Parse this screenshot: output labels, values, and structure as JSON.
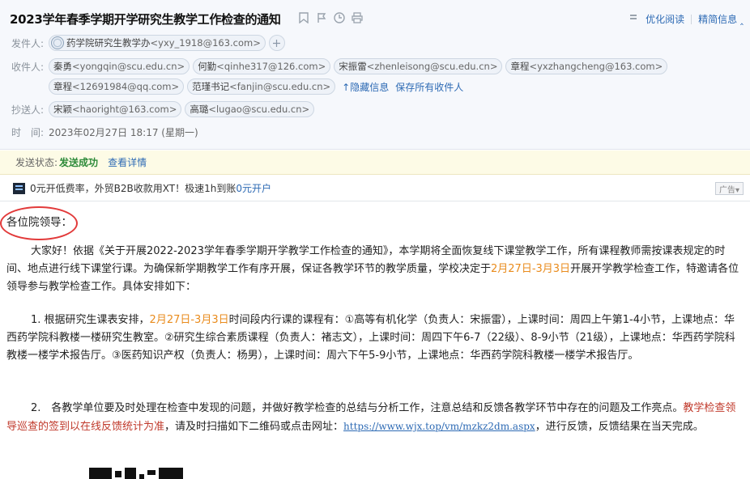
{
  "subject": "2023学年春季学期开学研究生教学工作检查的通知",
  "toolbar": {
    "optimize_read": "优化阅读",
    "collapse_info": "精简信息",
    "collapse_arrow": "‸"
  },
  "from": {
    "label": "发件人:",
    "name": "药学院研究生教学办",
    "email": "<yxy_1918@163.com>"
  },
  "to": {
    "label": "收件人:",
    "recipients": [
      {
        "name": "秦勇",
        "email": "<yongqin@scu.edu.cn>"
      },
      {
        "name": "何勤",
        "email": "<qinhe317@126.com>"
      },
      {
        "name": "宋振雷",
        "email": "<zhenleisong@scu.edu.cn>"
      },
      {
        "name": "章程",
        "email": "<yxzhangcheng@163.com>"
      },
      {
        "name": "章程",
        "email": "<12691984@qq.com>"
      },
      {
        "name": "范瑾书记",
        "email": "<fanjin@scu.edu.cn>"
      }
    ],
    "hide_label": "↑隐藏信息",
    "save_label": "保存所有收件人"
  },
  "cc": {
    "label": "抄送人:",
    "recipients": [
      {
        "name": "宋颖",
        "email": "<haoright@163.com>"
      },
      {
        "name": "高璐",
        "email": "<lugao@scu.edu.cn>"
      }
    ]
  },
  "time": {
    "label": "时　间:",
    "value": "2023年02月27日 18:17 (星期一)"
  },
  "status": {
    "label": "发送状态:",
    "value": "发送成功",
    "details": "查看详情"
  },
  "ad": {
    "text": "0元开低费率，外贸B2B收款用XT！极速1h到账 ",
    "link": "0元开户",
    "badge": "广告▾"
  },
  "body": {
    "greeting": "各位院领导：",
    "p1_a": "大家好！依据《关于开展2022-2023学年春季学期开学教学工作检查的通知》，本学期将全面恢复线下课堂教学工作，所有课程教师需按课表规定的时间、地点进行线下课堂行课。为确保新学期教学工作有序开展，保证各教学环节的教学质量，学校决定于",
    "p1_date": "2月27日-3月3日",
    "p1_b": "开展开学教学检查工作，特邀请各位领导参与教学检查工作。具体安排如下：",
    "p2_a": "1. 根据研究生课表安排，",
    "p2_date": "2月27日-3月3日",
    "p2_b": "时间段内行课的课程有：①高等有机化学（负责人：宋振雷），上课时间：周四上午第1-4小节，上课地点：华西药学院科教楼一楼研究生教室。②研究生综合素质课程（负责人：褚志文），上课时间：周四下午6-7（22级）、8-9小节（21级），上课地点：华西药学院科教楼一楼学术报告厅。③医药知识产权（负责人：杨男），上课时间：周六下午5-9小节，上课地点：华西药学院科教楼一楼学术报告厅。",
    "p3_a": "2.　各教学单位要及时处理在检查中发现的问题，并做好教学检查的总结与分析工作，注意总结和反馈各教学环节中存在的问题及工作亮点。",
    "p3_red": "教学检查领导巡查的签到以在线反馈统计为准",
    "p3_b": "，请及时扫描如下二维码或点击网址：",
    "p3_url": "https://www.wjx.top/vm/mzkz2dm.aspx",
    "p3_c": "，进行反馈，反馈结果在当天完成。"
  }
}
